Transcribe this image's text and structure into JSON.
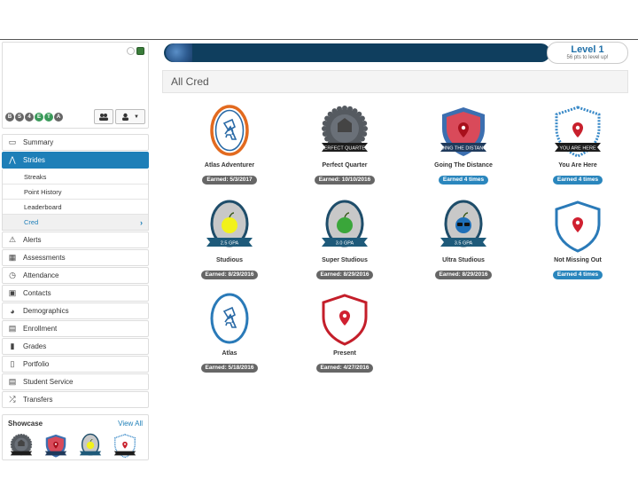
{
  "sidebar": {
    "profile_tags": [
      "B",
      "S",
      "4",
      "E",
      "T",
      "A"
    ],
    "nav_top": [
      {
        "label": "Summary",
        "icon": "id-card-icon"
      },
      {
        "label": "Strides",
        "icon": "strides-icon"
      }
    ],
    "sub_items": [
      {
        "label": "Streaks"
      },
      {
        "label": "Point History"
      },
      {
        "label": "Leaderboard"
      },
      {
        "label": "Cred"
      }
    ],
    "nav_bottom": [
      {
        "label": "Alerts",
        "icon": "warning-icon",
        "glyph": "⚠"
      },
      {
        "label": "Assessments",
        "icon": "chart-icon",
        "glyph": "▦"
      },
      {
        "label": "Attendance",
        "icon": "clock-icon",
        "glyph": "◷"
      },
      {
        "label": "Contacts",
        "icon": "contact-icon",
        "glyph": "▣"
      },
      {
        "label": "Demographics",
        "icon": "globe-icon",
        "glyph": "◕"
      },
      {
        "label": "Enrollment",
        "icon": "book-icon",
        "glyph": "▤"
      },
      {
        "label": "Grades",
        "icon": "notebook-icon",
        "glyph": "▮"
      },
      {
        "label": "Portfolio",
        "icon": "file-icon",
        "glyph": "▯"
      },
      {
        "label": "Student Service",
        "icon": "list-icon",
        "glyph": "▤"
      },
      {
        "label": "Transfers",
        "icon": "shuffle-icon",
        "glyph": "⤮"
      }
    ],
    "showcase": {
      "title": "Showcase",
      "view_all": "View All"
    }
  },
  "progress": {
    "level": "Level 1",
    "points_text": "56 pts to level up!"
  },
  "page_title": "All Cred",
  "creds": [
    {
      "name": "Atlas Adventurer",
      "status": "Earned: 5/3/2017",
      "style": "atlas-orange",
      "banner": ""
    },
    {
      "name": "Perfect Quarter",
      "status": "Earned: 10/10/2016",
      "style": "gear",
      "banner": "PERFECT QUARTER"
    },
    {
      "name": "Going The Distance",
      "status": "Earned 4 times",
      "style": "shield-red",
      "banner": "GOING THE DISTANCE"
    },
    {
      "name": "You Are Here",
      "status": "Earned 4 times",
      "style": "shield-blue",
      "banner": "YOU ARE HERE"
    },
    {
      "name": "Studious",
      "status": "Earned: 8/29/2016",
      "style": "gpa-yellow",
      "banner": "2.5 GPA"
    },
    {
      "name": "Super Studious",
      "status": "Earned: 8/29/2016",
      "style": "gpa-green",
      "banner": "3.0 GPA"
    },
    {
      "name": "Ultra Studious",
      "status": "Earned: 8/29/2016",
      "style": "gpa-blue",
      "banner": "3.5 GPA"
    },
    {
      "name": "Not Missing Out",
      "status": "Earned 4 times",
      "style": "shield-outline-blue",
      "banner": ""
    },
    {
      "name": "Atlas",
      "status": "Earned: 5/18/2016",
      "style": "atlas-blue",
      "banner": ""
    },
    {
      "name": "Present",
      "status": "Earned: 4/27/2016",
      "style": "shield-outline-red",
      "banner": ""
    }
  ],
  "colors": {
    "accent": "#1e7fb8",
    "xp_bar": "#0f3e5e",
    "pill_gray": "#666666",
    "pill_blue": "#2a86bd"
  }
}
